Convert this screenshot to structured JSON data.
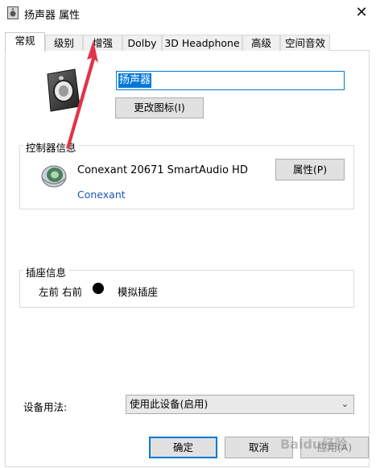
{
  "window": {
    "title": "扬声器 属性",
    "close_glyph": "✕"
  },
  "tabs": [
    {
      "label": "常规",
      "active": true
    },
    {
      "label": "级别",
      "active": false
    },
    {
      "label": "增强",
      "active": false
    },
    {
      "label": "Dolby",
      "active": false
    },
    {
      "label": "3D Headphone",
      "active": false
    },
    {
      "label": "高级",
      "active": false
    },
    {
      "label": "空间音效",
      "active": false
    }
  ],
  "general": {
    "device_name": "扬声器",
    "change_icon_label": "更改图标(I)"
  },
  "controller": {
    "group_title": "控制器信息",
    "name": "Conexant 20671 SmartAudio HD",
    "vendor": "Conexant",
    "properties_label": "属性(P)"
  },
  "jack": {
    "group_title": "插座信息",
    "location": "左前 右前",
    "type": "模拟插座"
  },
  "usage": {
    "label": "设备用法:",
    "selected": "使用此设备(启用)"
  },
  "footer": {
    "ok_label": "确定",
    "cancel_label": "取消",
    "apply_label": "应用(A)"
  },
  "watermark": "Baidu经验",
  "colors": {
    "accent": "#0078d7",
    "annotation_arrow": "#e0344a",
    "link": "#1b56b4"
  }
}
